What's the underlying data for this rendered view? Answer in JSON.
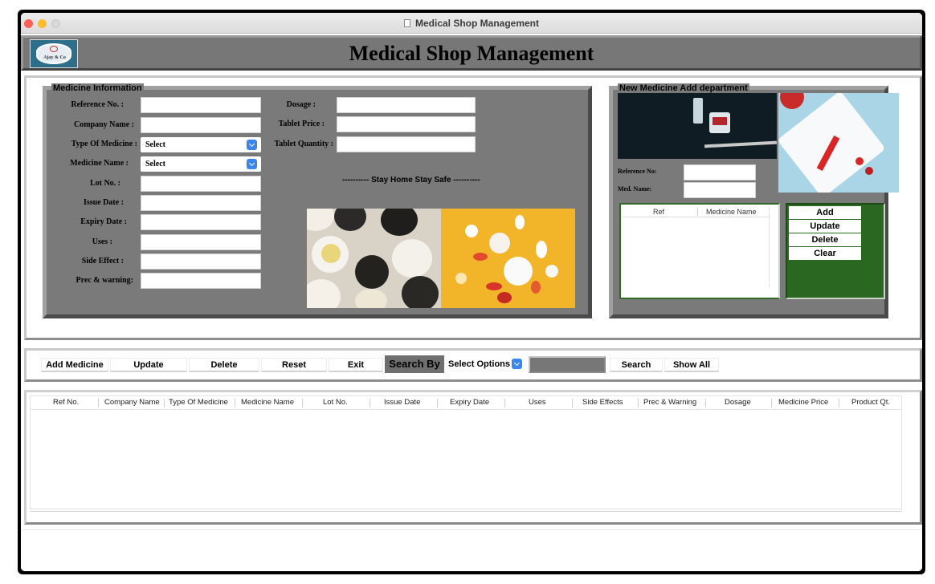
{
  "window": {
    "title": "Medical Shop Management"
  },
  "header": {
    "title": "Medical Shop Management",
    "logo_text": "Ajay & Co"
  },
  "medicine_info": {
    "legend": "Medicine Information",
    "fields_left": [
      {
        "label": "Reference No. :",
        "value": ""
      },
      {
        "label": "Company Name  :",
        "value": ""
      },
      {
        "label": "Type Of Medicine :",
        "value": "Select"
      },
      {
        "label": "Medicine Name :",
        "value": "Select"
      },
      {
        "label": "Lot No. :",
        "value": ""
      },
      {
        "label": "Issue Date :",
        "value": ""
      },
      {
        "label": "Expiry Date :",
        "value": ""
      },
      {
        "label": "Uses :",
        "value": ""
      },
      {
        "label": "Side Effect :",
        "value": ""
      },
      {
        "label": "Prec & warning:",
        "value": ""
      }
    ],
    "fields_right": [
      {
        "label": "Dosage :",
        "value": ""
      },
      {
        "label": "Tablet Price :",
        "value": ""
      },
      {
        "label": "Tablet Quantity :",
        "value": ""
      }
    ],
    "slogan": "---------- Stay Home Stay Safe ----------"
  },
  "new_medicine": {
    "legend": "New Medicine Add department",
    "ref_label": "Reference No:",
    "name_label": "Med. Name:",
    "ref_value": "",
    "name_value": "",
    "table_headers": [
      "Ref",
      "Medicine Name"
    ],
    "buttons": [
      "Add",
      "Update",
      "Delete",
      "Clear"
    ]
  },
  "toolbar": {
    "add_medicine": "Add Medicine",
    "update": "Update",
    "delete": "Delete",
    "reset": "Reset",
    "exit": "Exit",
    "search_by": "Search By",
    "select_options": "Select Options",
    "search_value": "",
    "search": "Search",
    "show_all": "Show All"
  },
  "table": {
    "headers": [
      "Ref No.",
      "Company Name",
      "Type Of Medicine",
      "Medicine Name",
      "Lot No.",
      "Issue Date",
      "Expiry Date",
      "Uses",
      "Side Effects",
      "Prec & Warning",
      "Dosage",
      "Medicine Price",
      "Product Qt."
    ],
    "rows": []
  },
  "colors": {
    "panel_gray": "#7a7a7a",
    "accent_green": "#2a6821",
    "select_blue": "#3a86f0"
  }
}
